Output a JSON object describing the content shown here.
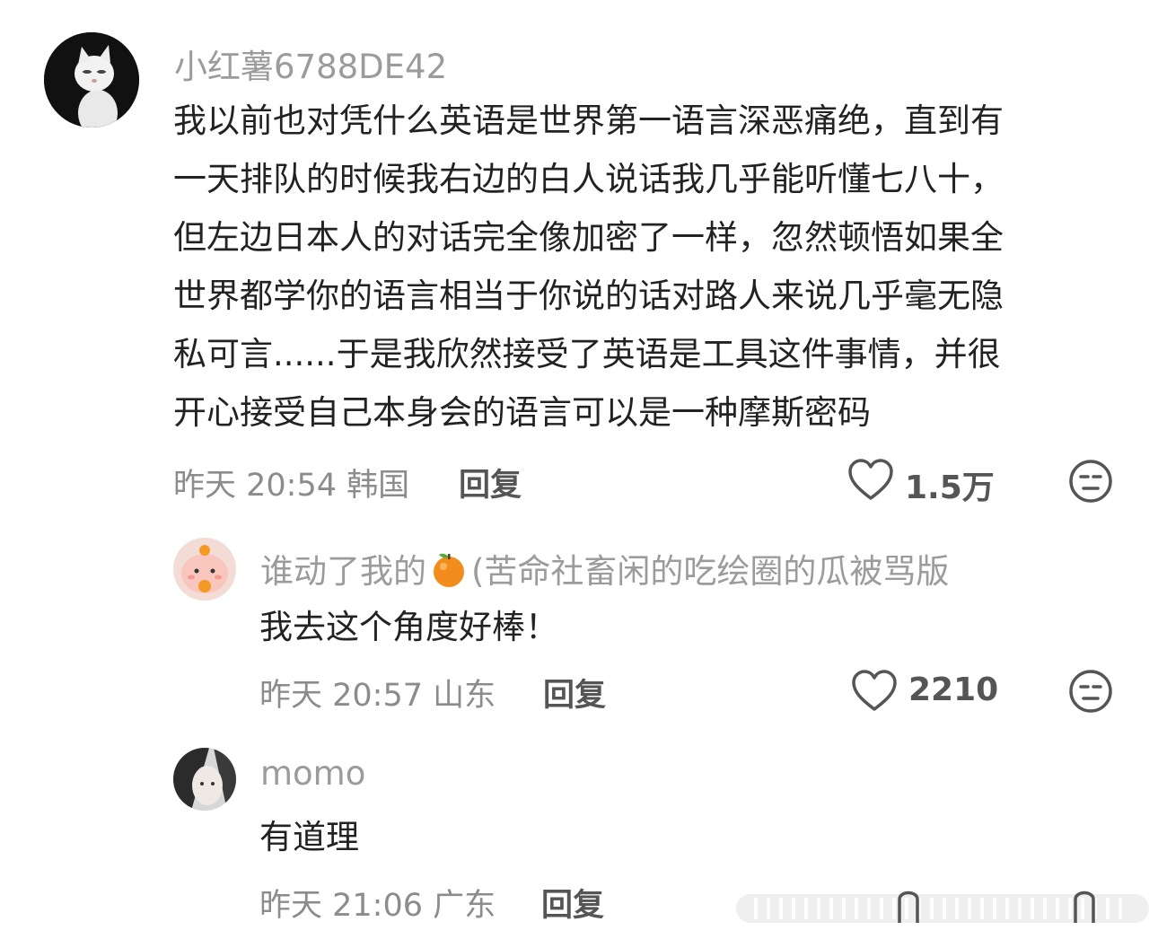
{
  "comments": [
    {
      "username": "小红薯6788DE42",
      "text": "我以前也对凭什么英语是世界第一语言深恶痛绝，直到有一天排队的时候我右边的白人说话我几乎能听懂七八十，但左边日本人的对话完全像加密了一样，忽然顿悟如果全世界都学你的语言相当于你说的话对路人来说几乎毫无隐私可言......于是我欣然接受了英语是工具这件事情，并很开心接受自己本身会的语言可以是一种摩斯密码",
      "lines": [
        "我以前也对凭什么英语是世界第一语言深恶痛绝，直到有",
        "一天排队的时候我右边的白人说话我几乎能听懂七八十，",
        "但左边日本人的对话完全像加密了一样，忽然顿悟如果全",
        "世界都学你的语言相当于你说的话对路人来说几乎毫无隐",
        "私可言......于是我欣然接受了英语是工具这件事情，并很",
        "开心接受自己本身会的语言可以是一种摩斯密码"
      ],
      "meta": "昨天 20:54 韩国",
      "reply_label": "回复",
      "likes": "1.5万"
    },
    {
      "username_prefix": "谁动了我的",
      "username_suffix": "(苦命社畜闲的吃绘圈的瓜被骂版",
      "username_emoji": "tangerine-emoji",
      "text": "我去这个角度好棒！",
      "meta": "昨天 20:57 山东",
      "reply_label": "回复",
      "likes": "2210"
    },
    {
      "username": "momo",
      "text": "有道理",
      "meta": "昨天 21:06 广东",
      "reply_label": "回复"
    }
  ],
  "colors": {
    "username": "#9b9b9b",
    "text": "#222222",
    "meta": "#8c8c8c",
    "orange": "#f28c1c"
  },
  "icons": [
    "heart-outline-icon",
    "meh-face-icon"
  ]
}
